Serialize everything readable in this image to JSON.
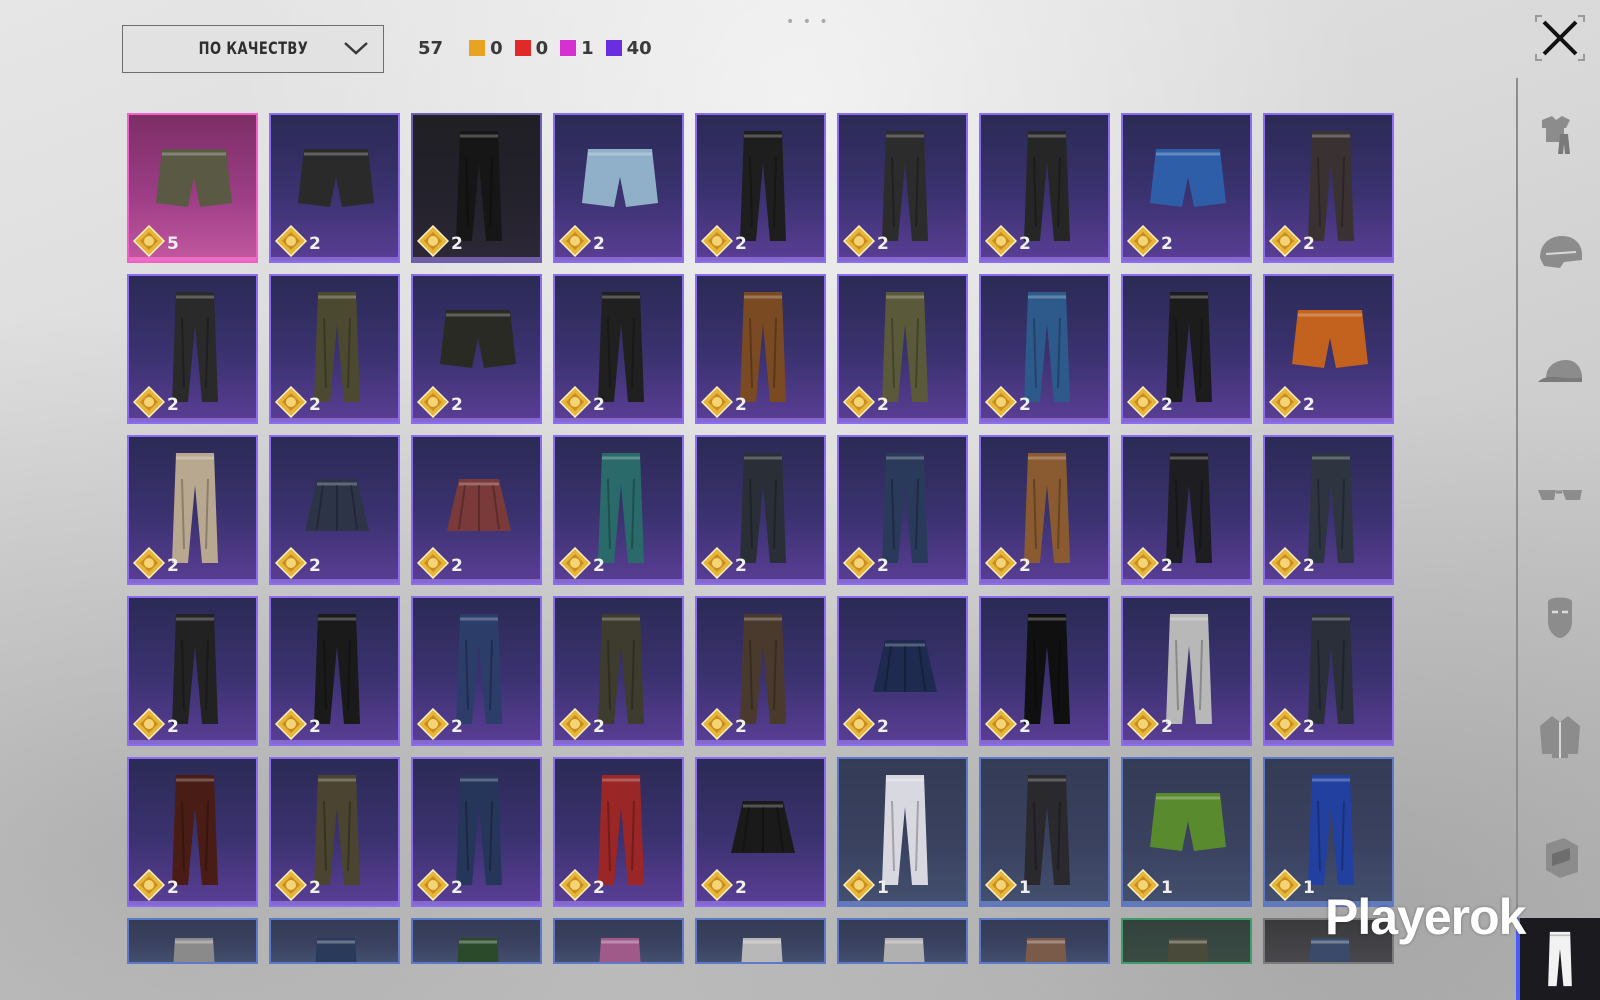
{
  "header": {
    "sort_label": "ПО КАЧЕСТВУ",
    "total_count": "57",
    "quality_counts": [
      {
        "color": "#e8a325",
        "value": "0"
      },
      {
        "color": "#e02a2a",
        "value": "0"
      },
      {
        "color": "#d62fd2",
        "value": "1"
      },
      {
        "color": "#6a2ee0",
        "value": "40"
      }
    ]
  },
  "sidebar": {
    "categories": [
      {
        "name": "outfit",
        "icon": "outfit-icon"
      },
      {
        "name": "helmet",
        "icon": "helmet-icon"
      },
      {
        "name": "hat",
        "icon": "cap-icon"
      },
      {
        "name": "glasses",
        "icon": "glasses-icon"
      },
      {
        "name": "mask",
        "icon": "mask-icon"
      },
      {
        "name": "jacket",
        "icon": "jacket-icon"
      },
      {
        "name": "backpack",
        "icon": "backpack-icon"
      },
      {
        "name": "pants",
        "icon": "pants-icon",
        "active": true
      }
    ]
  },
  "inventory": {
    "items": [
      {
        "type": "shorts",
        "color": "#5a5a44",
        "qty": "5",
        "quality": "pink"
      },
      {
        "type": "shorts",
        "color": "#2a2a2a",
        "qty": "2",
        "quality": "purple"
      },
      {
        "type": "pants",
        "color": "#161616",
        "qty": "2",
        "quality": "dark"
      },
      {
        "type": "shorts",
        "color": "#8fb0c8",
        "qty": "2",
        "quality": "purple"
      },
      {
        "type": "pants",
        "color": "#1e1e1e",
        "qty": "2",
        "quality": "purple"
      },
      {
        "type": "pants",
        "color": "#2c2c2c",
        "qty": "2",
        "quality": "purple"
      },
      {
        "type": "pants",
        "color": "#262626",
        "qty": "2",
        "quality": "purple"
      },
      {
        "type": "shorts",
        "color": "#2f5ea8",
        "qty": "2",
        "quality": "purple"
      },
      {
        "type": "pants",
        "color": "#3a3232",
        "qty": "2",
        "quality": "purple"
      },
      {
        "type": "pants",
        "color": "#2a2a2a",
        "qty": "2",
        "quality": "purple"
      },
      {
        "type": "pants",
        "color": "#4b4a30",
        "qty": "2",
        "quality": "purple"
      },
      {
        "type": "shorts",
        "color": "#2a2a24",
        "qty": "2",
        "quality": "purple"
      },
      {
        "type": "pants",
        "color": "#202020",
        "qty": "2",
        "quality": "purple"
      },
      {
        "type": "pants",
        "color": "#7a4a22",
        "qty": "2",
        "quality": "purple"
      },
      {
        "type": "pants",
        "color": "#5a5a3a",
        "qty": "2",
        "quality": "purple"
      },
      {
        "type": "pants",
        "color": "#2d5a8a",
        "qty": "2",
        "quality": "purple"
      },
      {
        "type": "pants",
        "color": "#1c1c1c",
        "qty": "2",
        "quality": "purple"
      },
      {
        "type": "shorts",
        "color": "#c2621e",
        "qty": "2",
        "quality": "purple"
      },
      {
        "type": "pants",
        "color": "#b8a890",
        "qty": "2",
        "quality": "purple"
      },
      {
        "type": "skirt",
        "color": "#2d3448",
        "qty": "2",
        "quality": "purple"
      },
      {
        "type": "skirt",
        "color": "#7a3a3a",
        "qty": "2",
        "quality": "purple"
      },
      {
        "type": "pants",
        "color": "#2a6a6a",
        "qty": "2",
        "quality": "purple"
      },
      {
        "type": "pants",
        "color": "#2a2e36",
        "qty": "2",
        "quality": "purple"
      },
      {
        "type": "pants",
        "color": "#2a3a5a",
        "qty": "2",
        "quality": "purple"
      },
      {
        "type": "pants",
        "color": "#8a5a30",
        "qty": "2",
        "quality": "purple"
      },
      {
        "type": "pants",
        "color": "#1e1e22",
        "qty": "2",
        "quality": "purple"
      },
      {
        "type": "pants",
        "color": "#2e3440",
        "qty": "2",
        "quality": "purple"
      },
      {
        "type": "pants",
        "color": "#222222",
        "qty": "2",
        "quality": "purple"
      },
      {
        "type": "pants",
        "color": "#1a1a1a",
        "qty": "2",
        "quality": "purple"
      },
      {
        "type": "pants",
        "color": "#2d3d6a",
        "qty": "2",
        "quality": "purple"
      },
      {
        "type": "pants",
        "color": "#3e3c2e",
        "qty": "2",
        "quality": "purple"
      },
      {
        "type": "pants",
        "color": "#4a3a2e",
        "qty": "2",
        "quality": "purple"
      },
      {
        "type": "skirt",
        "color": "#1e2a50",
        "qty": "2",
        "quality": "purple"
      },
      {
        "type": "pants",
        "color": "#101010",
        "qty": "2",
        "quality": "purple"
      },
      {
        "type": "pants",
        "color": "#b8b8b8",
        "qty": "2",
        "quality": "purple"
      },
      {
        "type": "pants",
        "color": "#2a2f3a",
        "qty": "2",
        "quality": "purple"
      },
      {
        "type": "pants",
        "color": "#4a1c16",
        "qty": "2",
        "quality": "purple"
      },
      {
        "type": "pants",
        "color": "#4a4430",
        "qty": "2",
        "quality": "purple"
      },
      {
        "type": "pants",
        "color": "#26365a",
        "qty": "2",
        "quality": "purple"
      },
      {
        "type": "pants",
        "color": "#9a2626",
        "qty": "2",
        "quality": "purple"
      },
      {
        "type": "skirt",
        "color": "#1a1a1a",
        "qty": "2",
        "quality": "purple"
      },
      {
        "type": "pants",
        "color": "#d8d8e0",
        "qty": "1",
        "quality": "blue"
      },
      {
        "type": "pants",
        "color": "#2a2a2e",
        "qty": "1",
        "quality": "blue"
      },
      {
        "type": "shorts",
        "color": "#5a8a2e",
        "qty": "1",
        "quality": "blue"
      },
      {
        "type": "pants",
        "color": "#2240a0",
        "qty": "1",
        "quality": "blue"
      },
      {
        "type": "partial",
        "color": "#8a8a8a",
        "qty": "",
        "quality": "blue"
      },
      {
        "type": "partial",
        "color": "#2a3a5a",
        "qty": "",
        "quality": "blue"
      },
      {
        "type": "partial",
        "color": "#2a4a2a",
        "qty": "",
        "quality": "blue"
      },
      {
        "type": "partial",
        "color": "#a05a8a",
        "qty": "",
        "quality": "blue"
      },
      {
        "type": "partial",
        "color": "#b8b8b8",
        "qty": "",
        "quality": "blue"
      },
      {
        "type": "partial",
        "color": "#b0b0b0",
        "qty": "",
        "quality": "blue"
      },
      {
        "type": "partial",
        "color": "#7a5a48",
        "qty": "",
        "quality": "blue"
      },
      {
        "type": "partial",
        "color": "#4a4a3a",
        "qty": "",
        "quality": "green"
      },
      {
        "type": "partial",
        "color": "#3a4a6a",
        "qty": "",
        "quality": "grey"
      }
    ]
  },
  "watermark": "Playerok"
}
